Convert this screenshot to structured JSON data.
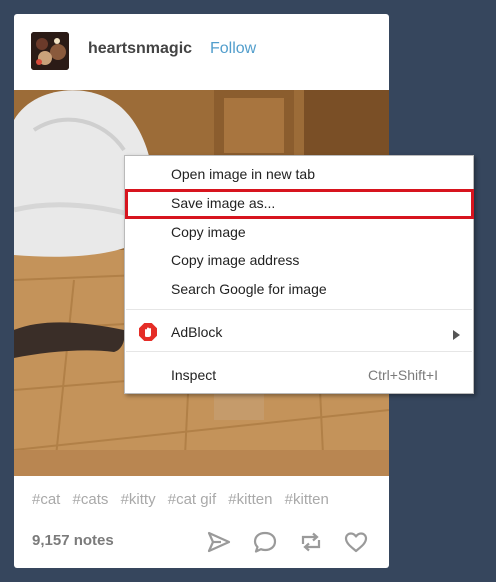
{
  "post": {
    "blog_name": "heartsnmagic",
    "follow_label": "Follow",
    "tags": [
      "#cat",
      "#cats",
      "#kitty",
      "#cat gif",
      "#kitten",
      "#kitten"
    ],
    "notes": "9,157 notes"
  },
  "context_menu": {
    "items": [
      {
        "label": "Open image in new tab"
      },
      {
        "label": "Save image as..."
      },
      {
        "label": "Copy image"
      },
      {
        "label": "Copy image address"
      },
      {
        "label": "Search Google for image"
      },
      {
        "label": "AdBlock"
      },
      {
        "label": "Inspect",
        "shortcut": "Ctrl+Shift+I"
      }
    ]
  },
  "icons": {
    "share": "paper-plane-icon",
    "reply": "speech-bubble-icon",
    "reblog": "reblog-icon",
    "like": "heart-icon",
    "adblock": "adblock-stop-icon",
    "submenu": "chevron-right-icon"
  },
  "colors": {
    "page_background": "#36465d",
    "follow_link": "#529ecc",
    "highlight_border": "#d7141e",
    "adblock_red": "#e52d27"
  }
}
